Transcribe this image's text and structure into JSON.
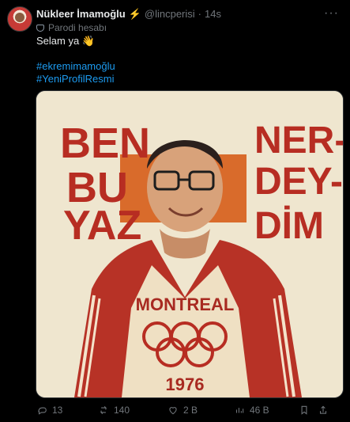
{
  "tweet": {
    "display_name": "Nükleer İmamoğlu",
    "handle": "@lincperisi",
    "time_separator": "·",
    "time": "14s",
    "parody_label": "Parodi hesabı",
    "text": {
      "line1": "Selam ya",
      "wave_emoji": "👋",
      "hashtag1": "#ekremimamoğlu",
      "hashtag2": "#YeniProfilResmi"
    }
  },
  "image": {
    "left_words": [
      "BEN",
      "BU",
      "YAZ"
    ],
    "right_words": [
      "NER-",
      "DEY-",
      "DİM"
    ],
    "shirt_text": "MONTREAL",
    "year": "1976"
  },
  "actions": {
    "reply_count": "13",
    "repost_count": "140",
    "like_count": "2 B",
    "view_count": "46 B"
  },
  "icons": {
    "more": "more-icon",
    "bolt": "lightning-icon",
    "mask": "parody-mask-icon",
    "reply": "reply-icon",
    "repost": "repost-icon",
    "like": "like-icon",
    "views": "views-icon",
    "bookmark": "bookmark-icon",
    "share": "share-icon"
  },
  "colors": {
    "background": "#000000",
    "text": "#e7e9ea",
    "muted": "#71767b",
    "hashtag": "#1d9bf0",
    "poster_red": "#b72d22",
    "poster_cream": "#efe6cf",
    "poster_orange": "#d96b2b"
  }
}
